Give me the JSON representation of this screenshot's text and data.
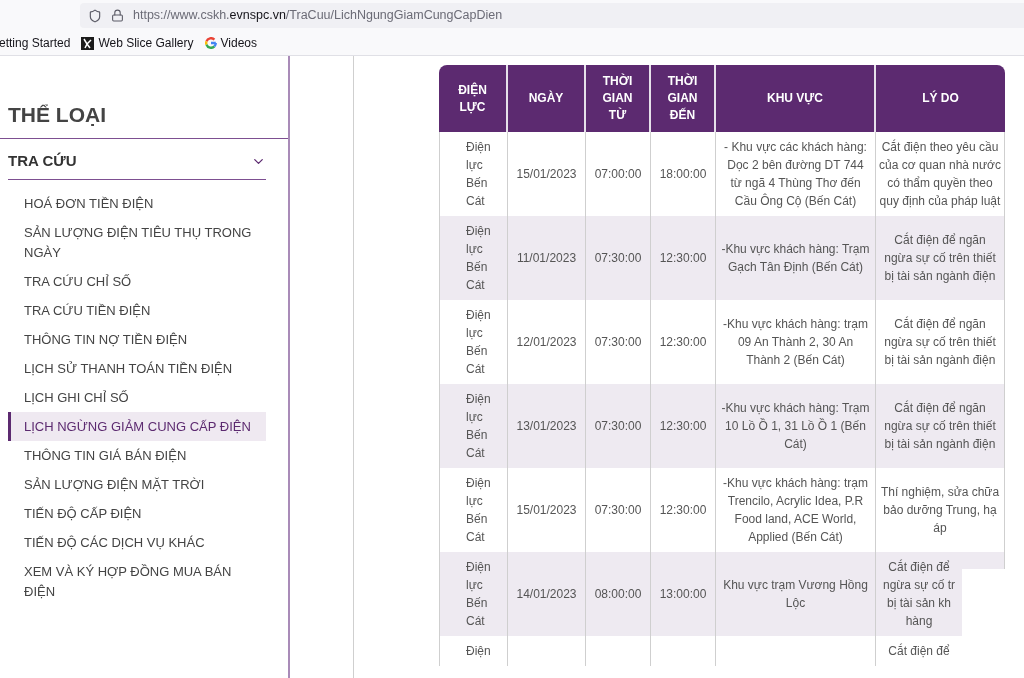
{
  "browser": {
    "url": {
      "prefix": "https://www.cskh.",
      "domain": "evnspc.vn",
      "path": "/TraCuu/LichNgungGiamCungCapDien"
    },
    "bookmarks": [
      {
        "label": "etting Started",
        "kind": "plain"
      },
      {
        "label": "Web Slice Gallery",
        "kind": "slice"
      },
      {
        "label": "Videos",
        "kind": "g"
      }
    ]
  },
  "sidebar": {
    "title": "THỂ LOẠI",
    "section": {
      "label": "TRA CỨU",
      "expanded": true,
      "items": [
        {
          "label": "HOÁ ĐƠN TIỀN ĐIỆN",
          "selected": false
        },
        {
          "label": "SẢN LƯỢNG ĐIỆN TIÊU THỤ TRONG NGÀY",
          "selected": false
        },
        {
          "label": "TRA CỨU CHỈ SỐ",
          "selected": false
        },
        {
          "label": "TRA CỨU TIỀN ĐIỆN",
          "selected": false
        },
        {
          "label": "THÔNG TIN NỢ TIỀN ĐIỆN",
          "selected": false
        },
        {
          "label": "LỊCH SỬ THANH TOÁN TIỀN ĐIỆN",
          "selected": false
        },
        {
          "label": "LỊCH GHI CHỈ SỐ",
          "selected": false
        },
        {
          "label": "LỊCH NGỪNG GIẢM CUNG CẤP ĐIỆN",
          "selected": true
        },
        {
          "label": "THÔNG TIN GIÁ BÁN ĐIỆN",
          "selected": false
        },
        {
          "label": "SẢN LƯỢNG ĐIỆN MẶT TRỜI",
          "selected": false
        },
        {
          "label": "TIẾN ĐỘ CẤP ĐIỆN",
          "selected": false
        },
        {
          "label": "TIẾN ĐỘ CÁC DỊCH VỤ KHÁC",
          "selected": false
        },
        {
          "label": "XEM VÀ KÝ HỢP ĐỒNG MUA BÁN ĐIỆN",
          "selected": false
        }
      ]
    }
  },
  "table": {
    "columns": [
      "ĐIỆN LỰC",
      "NGÀY",
      "THỜI GIAN TỪ",
      "THỜI GIAN ĐẾN",
      "KHU VỰC",
      "LÝ DO"
    ],
    "rows": [
      {
        "provider": "Điện lực Bến Cát",
        "date": "15/01/2023",
        "start": "07:00:00",
        "end": "18:00:00",
        "area": "- Khu vực các khách hàng: Dọc 2 bên đường DT 744 từ ngã 4 Thùng Thơ đến Cầu Ông Cộ (Bến Cát)",
        "reason": "Cắt điện theo yêu cầu của cơ quan nhà nước có thẩm quyền theo quy định của pháp luật",
        "covered_by_popup": false
      },
      {
        "provider": "Điện lực Bến Cát",
        "date": "11/01/2023",
        "start": "07:30:00",
        "end": "12:30:00",
        "area": "-Khu vực khách hàng: Trạm Gạch Tân Định (Bến Cát)",
        "reason": "Cắt điện để ngăn ngừa sự cố trên thiết bị tài sản ngành điện",
        "covered_by_popup": false
      },
      {
        "provider": "Điện lực Bến Cát",
        "date": "12/01/2023",
        "start": "07:30:00",
        "end": "12:30:00",
        "area": "-Khu vực khách hàng: trạm 09 An Thành 2, 30 An Thành 2 (Bến Cát)",
        "reason": "Cắt điện để ngăn ngừa sự cố trên thiết bị tài sản ngành điện",
        "covered_by_popup": false
      },
      {
        "provider": "Điện lực Bến Cát",
        "date": "13/01/2023",
        "start": "07:30:00",
        "end": "12:30:00",
        "area": "-Khu vực khách hàng: Trạm 10 Lồ Ồ 1, 31 Lồ Ồ 1 (Bến Cát)",
        "reason": "Cắt điện để ngăn ngừa sự cố trên thiết bị tài sản ngành điện",
        "covered_by_popup": false
      },
      {
        "provider": "Điện lực Bến Cát",
        "date": "15/01/2023",
        "start": "07:30:00",
        "end": "12:30:00",
        "area": "-Khu vực khách hàng: trạm Trencilo, Acrylic Idea, P.R Food land, ACE World, Applied (Bến Cát)",
        "reason": "Thí nghiệm, sửa chữa bảo dưỡng Trung, hạ áp",
        "covered_by_popup": false
      },
      {
        "provider": "Điện lực Bến Cát",
        "date": "14/01/2023",
        "start": "08:00:00",
        "end": "13:00:00",
        "area": "Khu vực trạm Vương Hồng Lộc",
        "reason": "Cắt điện để\nngừa sự cố tr\nbị tài sản kh\nhàng",
        "covered_by_popup": true
      },
      {
        "provider": "Điện",
        "reason": "Cắt điện để",
        "covered_by_popup": true
      }
    ]
  }
}
